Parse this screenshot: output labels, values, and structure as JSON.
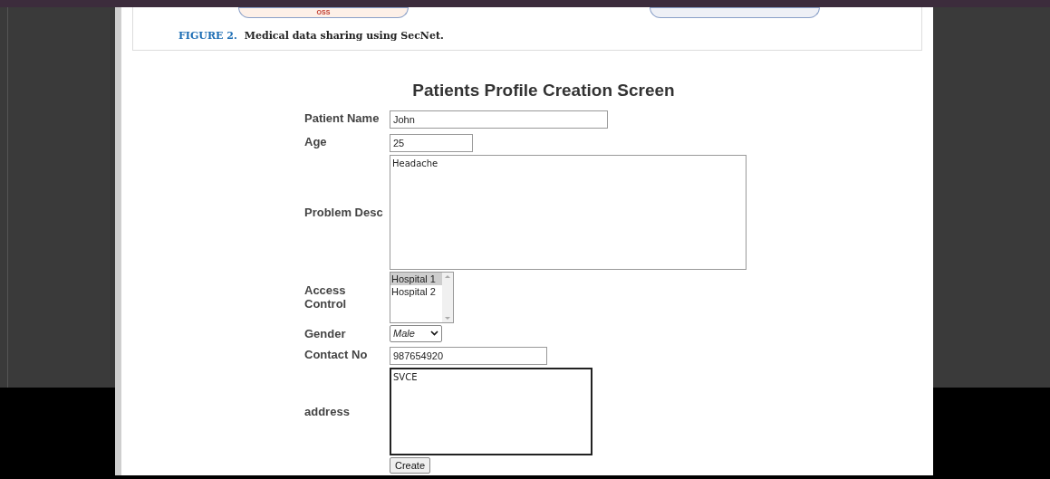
{
  "figure": {
    "box_label": "OSS",
    "caption_label": "FIGURE 2.",
    "caption": "Medical data sharing using SecNet."
  },
  "form": {
    "title": "Patients Profile Creation Screen",
    "fields": [
      {
        "kind": "text",
        "label_lines": [
          "Patient Name"
        ],
        "value": "John",
        "focused": false
      },
      {
        "kind": "text",
        "label_lines": [
          "Age"
        ],
        "value": "25",
        "focused": false
      },
      {
        "kind": "textarea",
        "label_lines": [
          "Problem Desc"
        ],
        "value": "Headache",
        "focused": false
      },
      {
        "kind": "listbox",
        "label_lines": [
          "Access",
          "Control"
        ],
        "options": [
          {
            "label": "Hospital 1",
            "selected": true
          },
          {
            "label": "Hospital 2",
            "selected": false
          }
        ]
      },
      {
        "kind": "select",
        "label_lines": [
          "Gender"
        ],
        "value": "Male"
      },
      {
        "kind": "text",
        "label_lines": [
          "Contact No"
        ],
        "value": "987654920",
        "focused": false
      },
      {
        "kind": "textarea",
        "label_lines": [
          "address"
        ],
        "value": "SVCE",
        "focused": true
      }
    ],
    "button": "Create"
  }
}
